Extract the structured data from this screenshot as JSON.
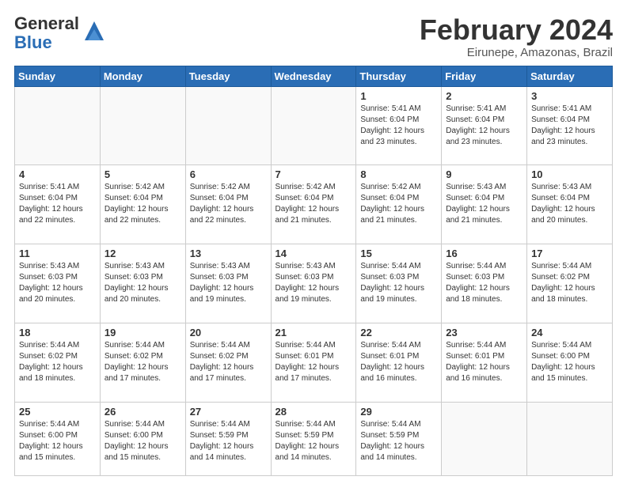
{
  "header": {
    "logo_general": "General",
    "logo_blue": "Blue",
    "title": "February 2024",
    "subtitle": "Eirunepe, Amazonas, Brazil"
  },
  "weekdays": [
    "Sunday",
    "Monday",
    "Tuesday",
    "Wednesday",
    "Thursday",
    "Friday",
    "Saturday"
  ],
  "weeks": [
    [
      {
        "day": "",
        "info": ""
      },
      {
        "day": "",
        "info": ""
      },
      {
        "day": "",
        "info": ""
      },
      {
        "day": "",
        "info": ""
      },
      {
        "day": "1",
        "info": "Sunrise: 5:41 AM\nSunset: 6:04 PM\nDaylight: 12 hours and 23 minutes."
      },
      {
        "day": "2",
        "info": "Sunrise: 5:41 AM\nSunset: 6:04 PM\nDaylight: 12 hours and 23 minutes."
      },
      {
        "day": "3",
        "info": "Sunrise: 5:41 AM\nSunset: 6:04 PM\nDaylight: 12 hours and 23 minutes."
      }
    ],
    [
      {
        "day": "4",
        "info": "Sunrise: 5:41 AM\nSunset: 6:04 PM\nDaylight: 12 hours and 22 minutes."
      },
      {
        "day": "5",
        "info": "Sunrise: 5:42 AM\nSunset: 6:04 PM\nDaylight: 12 hours and 22 minutes."
      },
      {
        "day": "6",
        "info": "Sunrise: 5:42 AM\nSunset: 6:04 PM\nDaylight: 12 hours and 22 minutes."
      },
      {
        "day": "7",
        "info": "Sunrise: 5:42 AM\nSunset: 6:04 PM\nDaylight: 12 hours and 21 minutes."
      },
      {
        "day": "8",
        "info": "Sunrise: 5:42 AM\nSunset: 6:04 PM\nDaylight: 12 hours and 21 minutes."
      },
      {
        "day": "9",
        "info": "Sunrise: 5:43 AM\nSunset: 6:04 PM\nDaylight: 12 hours and 21 minutes."
      },
      {
        "day": "10",
        "info": "Sunrise: 5:43 AM\nSunset: 6:04 PM\nDaylight: 12 hours and 20 minutes."
      }
    ],
    [
      {
        "day": "11",
        "info": "Sunrise: 5:43 AM\nSunset: 6:03 PM\nDaylight: 12 hours and 20 minutes."
      },
      {
        "day": "12",
        "info": "Sunrise: 5:43 AM\nSunset: 6:03 PM\nDaylight: 12 hours and 20 minutes."
      },
      {
        "day": "13",
        "info": "Sunrise: 5:43 AM\nSunset: 6:03 PM\nDaylight: 12 hours and 19 minutes."
      },
      {
        "day": "14",
        "info": "Sunrise: 5:43 AM\nSunset: 6:03 PM\nDaylight: 12 hours and 19 minutes."
      },
      {
        "day": "15",
        "info": "Sunrise: 5:44 AM\nSunset: 6:03 PM\nDaylight: 12 hours and 19 minutes."
      },
      {
        "day": "16",
        "info": "Sunrise: 5:44 AM\nSunset: 6:03 PM\nDaylight: 12 hours and 18 minutes."
      },
      {
        "day": "17",
        "info": "Sunrise: 5:44 AM\nSunset: 6:02 PM\nDaylight: 12 hours and 18 minutes."
      }
    ],
    [
      {
        "day": "18",
        "info": "Sunrise: 5:44 AM\nSunset: 6:02 PM\nDaylight: 12 hours and 18 minutes."
      },
      {
        "day": "19",
        "info": "Sunrise: 5:44 AM\nSunset: 6:02 PM\nDaylight: 12 hours and 17 minutes."
      },
      {
        "day": "20",
        "info": "Sunrise: 5:44 AM\nSunset: 6:02 PM\nDaylight: 12 hours and 17 minutes."
      },
      {
        "day": "21",
        "info": "Sunrise: 5:44 AM\nSunset: 6:01 PM\nDaylight: 12 hours and 17 minutes."
      },
      {
        "day": "22",
        "info": "Sunrise: 5:44 AM\nSunset: 6:01 PM\nDaylight: 12 hours and 16 minutes."
      },
      {
        "day": "23",
        "info": "Sunrise: 5:44 AM\nSunset: 6:01 PM\nDaylight: 12 hours and 16 minutes."
      },
      {
        "day": "24",
        "info": "Sunrise: 5:44 AM\nSunset: 6:00 PM\nDaylight: 12 hours and 15 minutes."
      }
    ],
    [
      {
        "day": "25",
        "info": "Sunrise: 5:44 AM\nSunset: 6:00 PM\nDaylight: 12 hours and 15 minutes."
      },
      {
        "day": "26",
        "info": "Sunrise: 5:44 AM\nSunset: 6:00 PM\nDaylight: 12 hours and 15 minutes."
      },
      {
        "day": "27",
        "info": "Sunrise: 5:44 AM\nSunset: 5:59 PM\nDaylight: 12 hours and 14 minutes."
      },
      {
        "day": "28",
        "info": "Sunrise: 5:44 AM\nSunset: 5:59 PM\nDaylight: 12 hours and 14 minutes."
      },
      {
        "day": "29",
        "info": "Sunrise: 5:44 AM\nSunset: 5:59 PM\nDaylight: 12 hours and 14 minutes."
      },
      {
        "day": "",
        "info": ""
      },
      {
        "day": "",
        "info": ""
      }
    ]
  ]
}
